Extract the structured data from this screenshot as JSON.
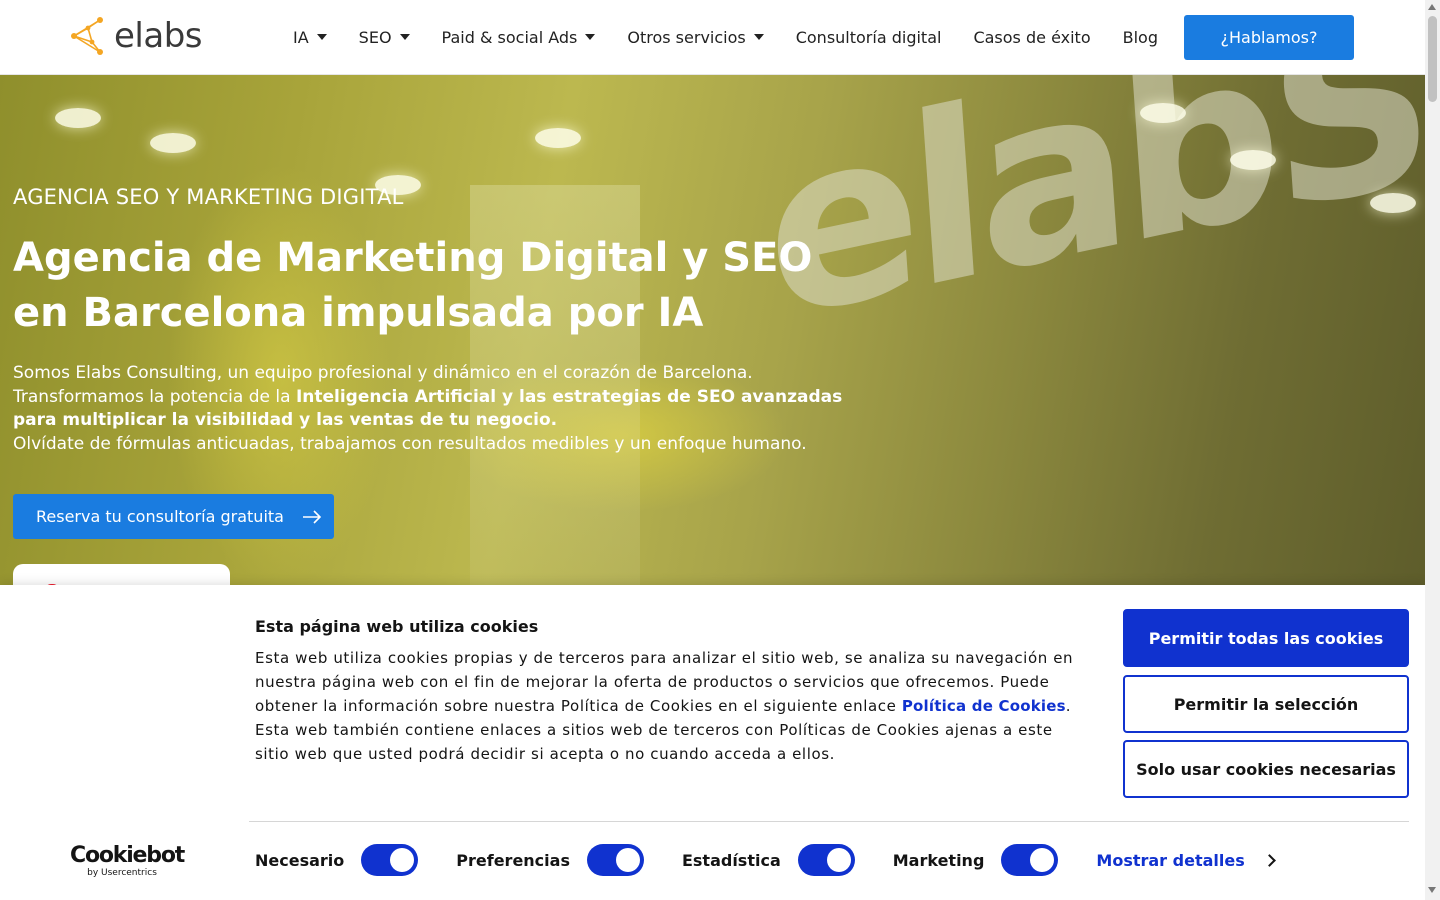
{
  "header": {
    "logo_text": "elabs",
    "nav": [
      {
        "label": "IA",
        "dropdown": true
      },
      {
        "label": "SEO",
        "dropdown": true
      },
      {
        "label": "Paid & social Ads",
        "dropdown": true
      },
      {
        "label": "Otros servicios",
        "dropdown": true
      },
      {
        "label": "Consultoría digital",
        "dropdown": false
      },
      {
        "label": "Casos de éxito",
        "dropdown": false
      },
      {
        "label": "Blog",
        "dropdown": false
      }
    ],
    "cta_label": "¿Hablamos?"
  },
  "hero": {
    "kicker": "AGENCIA SEO Y MARKETING DIGITAL",
    "title": "Agencia de Marketing Digital y SEO en Barcelona impulsada por IA",
    "body_line1": "Somos Elabs Consulting, un equipo profesional y dinámico en el corazón de Barcelona.",
    "body_line2_plain": "Transformamos la potencia de la ",
    "body_line2_bold": "Inteligencia Artificial y las estrategias de SEO avanzadas para multiplicar la visibilidad y las ventas de tu negocio.",
    "body_line3": "Olvídate de fórmulas anticuadas, trabajamos con resultados medibles y un enfoque humano.",
    "cta_label": "Reserva tu consultoría gratuita",
    "background_word": "elabS"
  },
  "cookie_banner": {
    "title": "Esta página web utiliza cookies",
    "text": "Esta web utiliza cookies propias y de terceros para analizar el sitio web, se analiza su navegación en nuestra página web con el fin de mejorar la oferta de productos o servicios que ofrecemos. Puede obtener la información sobre nuestra Política de Cookies en el siguiente enlace ",
    "link_label": "Política de Cookies",
    "text_after": ". Esta web también contiene enlaces a sitios web de terceros con Políticas de Cookies ajenas a este sitio web que usted podrá decidir si acepta o no cuando acceda a ellos.",
    "buttons": {
      "allow_all": "Permitir todas las cookies",
      "allow_selection": "Permitir la selección",
      "necessary_only": "Solo usar cookies necesarias"
    },
    "toggles": [
      {
        "label": "Necesario",
        "on": true
      },
      {
        "label": "Preferencias",
        "on": true
      },
      {
        "label": "Estadística",
        "on": true
      },
      {
        "label": "Marketing",
        "on": true
      }
    ],
    "show_details_label": "Mostrar detalles",
    "brand_main": "Cookiebot",
    "brand_sub": "by Usercentrics"
  },
  "colors": {
    "primary_blue": "#1a7ce0",
    "cookiebot_blue": "#1032cf",
    "logo_orange": "#f4a623"
  }
}
